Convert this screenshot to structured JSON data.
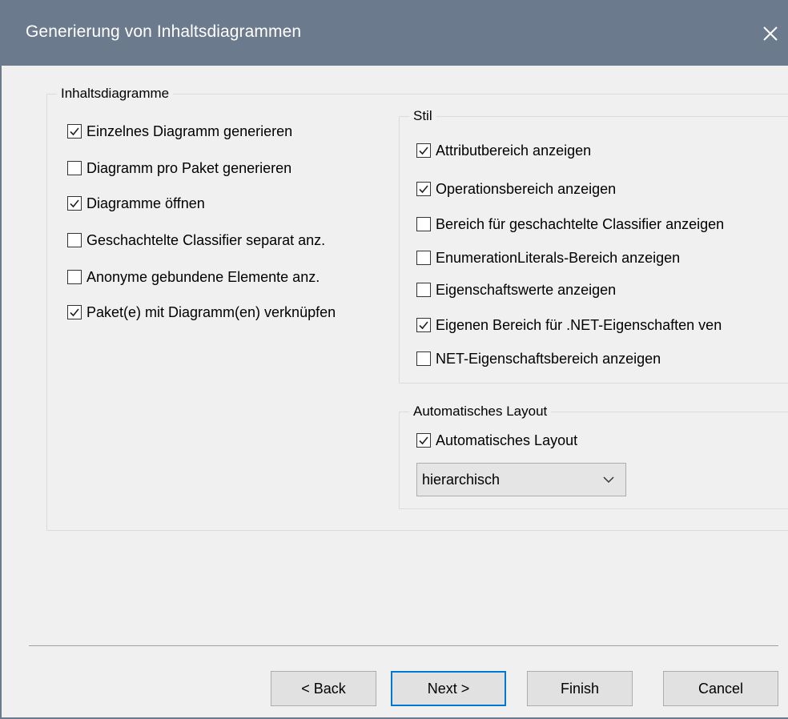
{
  "window": {
    "title": "Generierung von Inhaltsdiagrammen",
    "close_icon": "close-icon"
  },
  "content_group": {
    "label": "Inhaltsdiagramme",
    "options": [
      {
        "label": "Einzelnes Diagramm generieren",
        "checked": true
      },
      {
        "label": "Diagramm pro Paket generieren",
        "checked": false
      },
      {
        "label": "Diagramme öffnen",
        "checked": true
      },
      {
        "label": "Geschachtelte Classifier separat anz.",
        "checked": false
      },
      {
        "label": "Anonyme gebundene Elemente anz.",
        "checked": false
      },
      {
        "label": "Paket(e) mit Diagramm(en) verknüpfen",
        "checked": true
      }
    ]
  },
  "style_group": {
    "label": "Stil",
    "options": [
      {
        "label": "Attributbereich anzeigen",
        "checked": true
      },
      {
        "label": "Operationsbereich anzeigen",
        "checked": true
      },
      {
        "label": "Bereich für geschachtelte Classifier anzeigen",
        "checked": false
      },
      {
        "label": "EnumerationLiterals-Bereich anzeigen",
        "checked": false
      },
      {
        "label": "Eigenschaftswerte anzeigen",
        "checked": false
      },
      {
        "label": "Eigenen Bereich für .NET-Eigenschaften ven",
        "checked": true
      },
      {
        "label": "NET-Eigenschaftsbereich anzeigen",
        "checked": false
      }
    ]
  },
  "layout_group": {
    "label": "Automatisches Layout",
    "auto_layout": {
      "label": "Automatisches Layout",
      "checked": true
    },
    "layout_select": {
      "value": "hierarchisch"
    }
  },
  "buttons": {
    "back": "< Back",
    "next": "Next >",
    "finish": "Finish",
    "cancel": "Cancel"
  },
  "colors": {
    "titlebar": "#6c7a8e",
    "dialog_bg": "#f0f0f0",
    "focus_border": "#0078d7"
  }
}
